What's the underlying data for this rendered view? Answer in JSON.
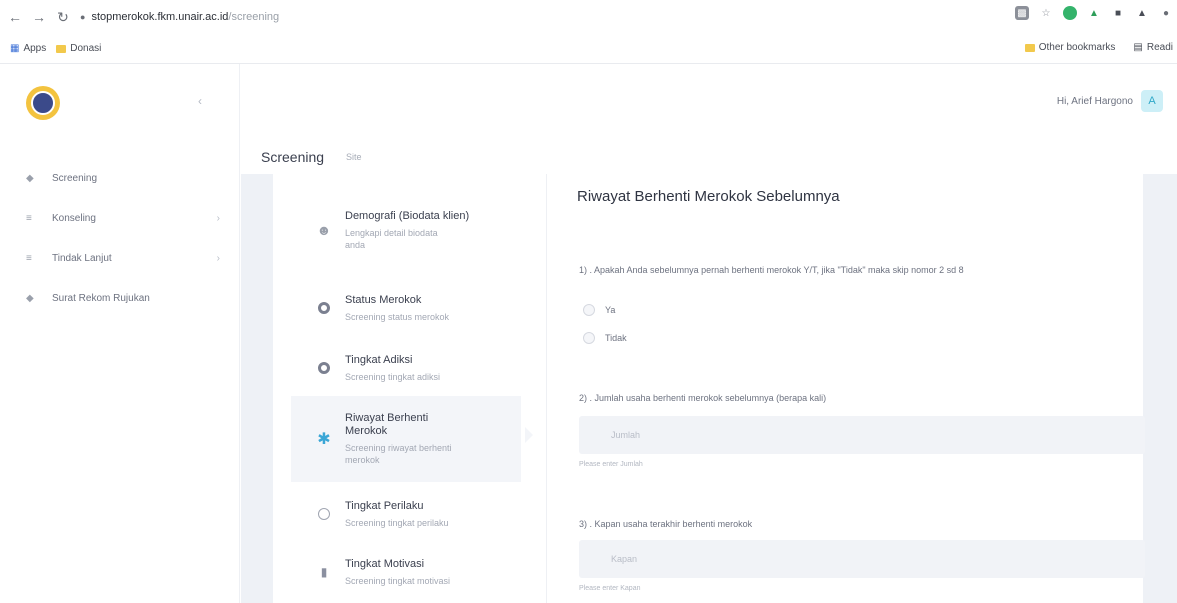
{
  "browser": {
    "url_host": "stopmerokok.fkm.unair.ac.id",
    "url_path": "/screening",
    "bookmarks": {
      "apps": "Apps",
      "donasi": "Donasi",
      "other": "Other bookmarks",
      "reading": "Readi"
    }
  },
  "sidebar": {
    "items": [
      {
        "label": "Screening",
        "icon": "bullet-icon",
        "has_arrow": false
      },
      {
        "label": "Konseling",
        "icon": "list-icon",
        "has_arrow": true
      },
      {
        "label": "Tindak Lanjut",
        "icon": "list-icon",
        "has_arrow": true
      },
      {
        "label": "Surat Rekom Rujukan",
        "icon": "bullet-icon",
        "has_arrow": false
      }
    ]
  },
  "header": {
    "user_greeting": "Hi, Arief Hargono",
    "avatar_letter": "A"
  },
  "page": {
    "title": "Screening",
    "subtitle": "Site"
  },
  "steps": [
    {
      "title": "Demografi (Biodata klien)",
      "desc": "Lengkapi detail biodata anda"
    },
    {
      "title": "Status Merokok",
      "desc": "Screening status merokok"
    },
    {
      "title": "Tingkat Adiksi",
      "desc": "Screening tingkat adiksi"
    },
    {
      "title": "Riwayat Berhenti Merokok",
      "desc": "Screening riwayat berhenti merokok"
    },
    {
      "title": "Tingkat Perilaku",
      "desc": "Screening tingkat perilaku"
    },
    {
      "title": "Tingkat Motivasi",
      "desc": "Screening tingkat motivasi"
    }
  ],
  "form": {
    "title": "Riwayat Berhenti Merokok Sebelumnya",
    "q1": "1) . Apakah Anda sebelumnya pernah berhenti merokok Y/T, jika \"Tidak\" maka skip nomor 2 sd 8",
    "q1_options": [
      "Ya",
      "Tidak"
    ],
    "q2": "2) . Jumlah usaha berhenti merokok sebelumnya (berapa kali)",
    "q2_placeholder": "Jumlah",
    "q2_help": "Please enter Jumlah",
    "q3": "3) . Kapan usaha terakhir berhenti merokok",
    "q3_placeholder": "Kapan",
    "q3_help": "Please enter Kapan"
  }
}
